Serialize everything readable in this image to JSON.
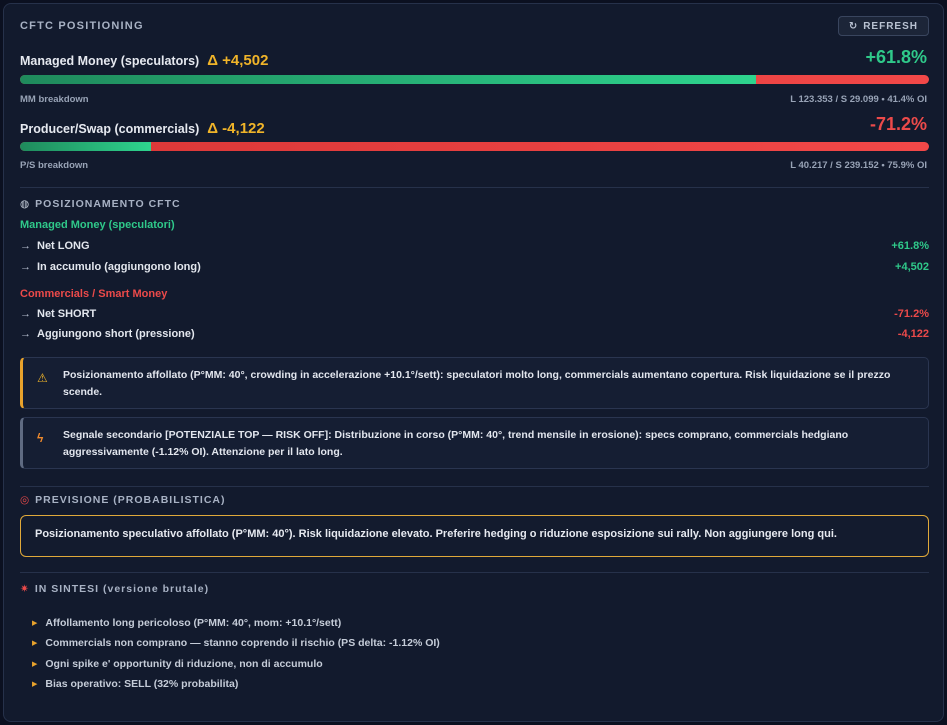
{
  "header": {
    "title": "CFTC POSITIONING",
    "refresh_label": "REFRESH",
    "refresh_icon": "refresh-icon"
  },
  "mm": {
    "title": "Managed Money (speculators)",
    "delta": "Δ +4,502",
    "pct": "+61.8%",
    "long_fraction": 0.81,
    "sub_label": "MM breakdown",
    "breakdown": "L 123.353 / S 29.099 • 41.4% OI"
  },
  "ps": {
    "title": "Producer/Swap (commercials)",
    "delta": "Δ -4,122",
    "pct": "-71.2%",
    "long_fraction": 0.144,
    "sub_label": "P/S breakdown",
    "breakdown": "L 40.217 / S 239.152 • 75.9% OI"
  },
  "positioning": {
    "icon": "globe-icon",
    "title": "POSIZIONAMENTO CFTC",
    "mm_group": "Managed Money (speculatori)",
    "mm_items": [
      {
        "arrow": "→",
        "label": "Net LONG",
        "value": "+61.8%"
      },
      {
        "arrow": "→",
        "label": "In accumulo (aggiungono long)",
        "value": "+4,502"
      }
    ],
    "cm_group": "Commercials / Smart Money",
    "cm_items": [
      {
        "arrow": "→",
        "label": "Net SHORT",
        "value": "-71.2%"
      },
      {
        "arrow": "→",
        "label": "Aggiungono short (pressione)",
        "value": "-4,122"
      }
    ]
  },
  "alerts": {
    "warning_icon": "warning-icon",
    "warning": "Posizionamento affollato (P°MM: 40°, crowding in accelerazione +10.1°/sett): speculatori molto long, commercials aumentano copertura. Risk liquidazione se il prezzo scende.",
    "signal_icon": "lightning-icon",
    "signal": "Segnale secondario [POTENZIALE TOP — RISK OFF]: Distribuzione in corso (P°MM: 40°, trend mensile in erosione): specs comprano, commercials hedgiano aggressivamente (-1.12% OI). Attenzione per il lato long."
  },
  "forecast": {
    "icon": "target-icon",
    "title": "PREVISIONE (PROBABILISTICA)",
    "text": "Posizionamento speculativo affollato (P°MM: 40°). Risk liquidazione elevato. Preferire hedging o riduzione esposizione sui rally. Non aggiungere long qui."
  },
  "summary": {
    "icon": "burst-icon",
    "title": "IN SINTESI (versione brutale)",
    "bullets": [
      "Affollamento long pericoloso (P°MM: 40°, mom: +10.1°/sett)",
      "Commercials non comprano — stanno coprendo il rischio (PS delta: -1.12% OI)",
      "Ogni spike e' opportunity di riduzione, non di accumulo",
      "Bias operativo: SELL (32% probabilita)"
    ]
  },
  "colors": {
    "green": "#2fc98a",
    "red": "#ec4a4a",
    "amber": "#f0b429"
  }
}
